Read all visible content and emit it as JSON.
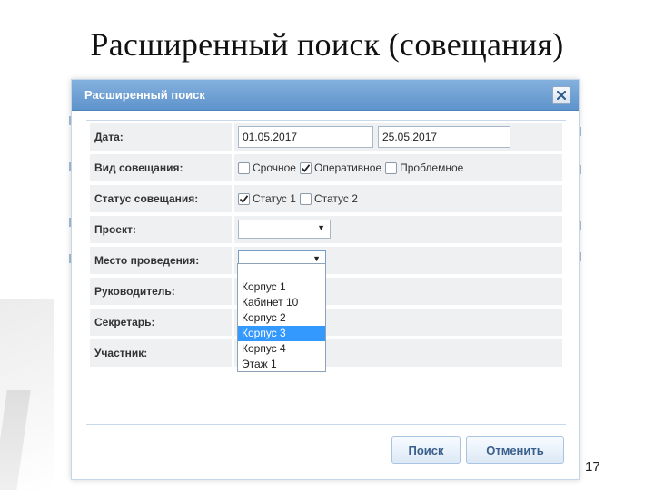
{
  "slide": {
    "title": "Расширенный поиск (совещания)",
    "number": "17"
  },
  "dialog": {
    "title": "Расширенный поиск",
    "close_icon": "close-x-icon",
    "fields": {
      "date": {
        "label": "Дата:",
        "from": "01.05.2017",
        "to": "25.05.2017"
      },
      "meeting_type": {
        "label": "Вид совещания:",
        "options": [
          {
            "label": "Срочное",
            "checked": false
          },
          {
            "label": "Оперативное",
            "checked": true
          },
          {
            "label": "Проблемное",
            "checked": false
          }
        ]
      },
      "meeting_status": {
        "label": "Статус совещания:",
        "options": [
          {
            "label": "Статус 1",
            "checked": true
          },
          {
            "label": "Статус 2",
            "checked": false
          }
        ]
      },
      "project": {
        "label": "Проект:",
        "value": ""
      },
      "venue": {
        "label": "Место проведения:",
        "value": "",
        "dropdown_open": true,
        "options": [
          "Корпус 1",
          "Кабинет 10",
          "Корпус 2",
          "Корпус 3",
          "Корпус 4",
          "Этаж 1"
        ],
        "highlighted": "Корпус 3"
      },
      "manager": {
        "label": "Руководитель:"
      },
      "secretary": {
        "label": "Секретарь:"
      },
      "participant": {
        "label": "Участник:"
      }
    },
    "buttons": {
      "search": "Поиск",
      "cancel": "Отменить"
    }
  },
  "colors": {
    "header_top": "#84b1dd",
    "header_bottom": "#5e93cc",
    "row_bg": "#eef0f2",
    "highlight": "#3399ff",
    "button_text": "#3a5f8a"
  }
}
